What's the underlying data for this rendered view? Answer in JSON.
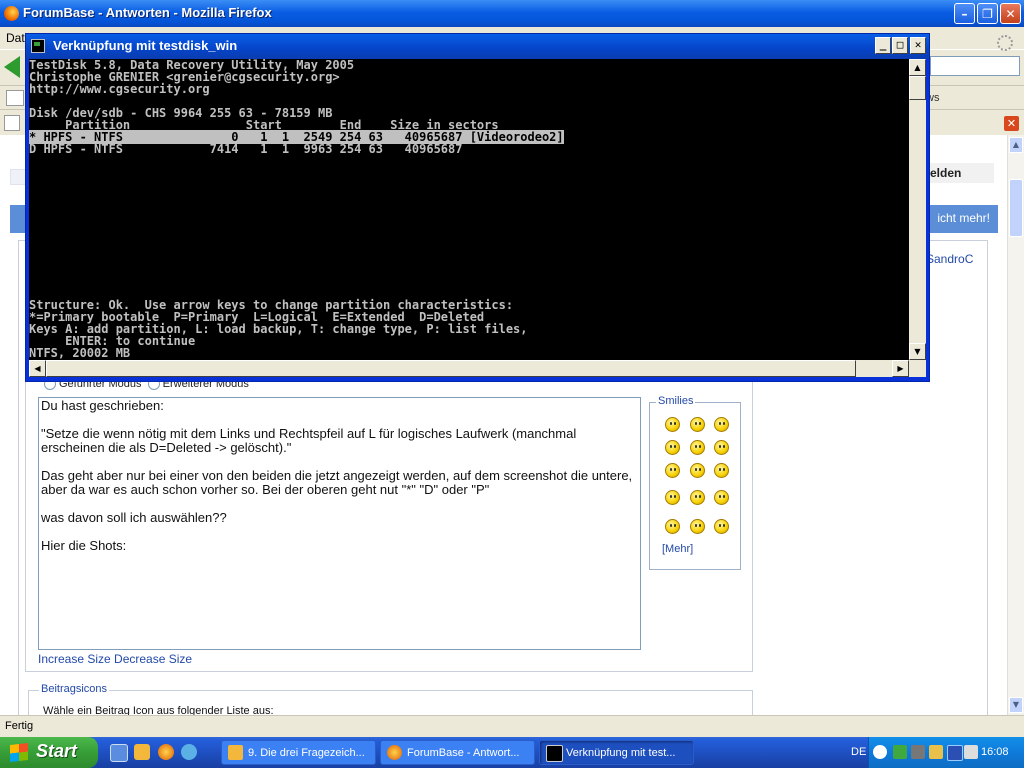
{
  "firefox": {
    "title": "ForumBase - Antworten - Mozilla Firefox",
    "menubar_visible": "Dat",
    "bookmark_partial": "ws",
    "status": "Fertig"
  },
  "page": {
    "melden": "elden",
    "bluebar_text": "icht mehr!",
    "user_link": "SandroC",
    "mode_guided": "Geführter Modus",
    "mode_extended": "Erweiterer Modus",
    "editor_paragraphs": [
      "Du hast geschrieben:",
      "\"Setze die wenn nötig mit dem Links und Rechtspfeil auf L für logisches Laufwerk (manchmal erscheinen die als D=Deleted -> gelöscht).\"",
      "Das geht aber nur bei einer von den beiden die jetzt angezeigt werden, auf dem screenshot die untere, aber da war es auch schon vorher so. Bei der oberen geht nut \"*\" \"D\" oder \"P\"",
      "was davon soll ich auswählen??",
      "Hier die Shots:"
    ],
    "increase_size": "Increase Size",
    "decrease_size": "Decrease Size",
    "smilies_legend": "Smilies",
    "smilies_more": "[Mehr]",
    "beitragsicons_legend": "Beitragsicons",
    "beitragsicons_desc": "Wähle ein Beitrag Icon aus folgender Liste aus:"
  },
  "console": {
    "title": "Verknüpfung mit testdisk_win",
    "lines": [
      "TestDisk 5.8, Data Recovery Utility, May 2005",
      "Christophe GRENIER <grenier@cgsecurity.org>",
      "http://www.cgsecurity.org",
      "",
      "Disk /dev/sdb - CHS 9964 255 63 - 78159 MB",
      "     Partition                Start        End    Size in sectors",
      "* HPFS - NTFS               0   1  1  2549 254 63   40965687 [Videorodeo2]",
      "D HPFS - NTFS            7414   1  1  9963 254 63   40965687",
      "",
      "",
      "",
      "",
      "",
      "",
      "",
      "",
      "",
      "",
      "",
      "",
      "Structure: Ok.  Use arrow keys to change partition characteristics:",
      "*=Primary bootable  P=Primary  L=Logical  E=Extended  D=Deleted",
      "Keys A: add partition, L: load backup, T: change type, P: list files,",
      "     ENTER: to continue",
      "NTFS, 20002 MB"
    ],
    "highlight_line": 6
  },
  "taskbar": {
    "start": "Start",
    "tasks": [
      "9. Die drei Fragezeich...",
      "ForumBase - Antwort...",
      "Verknüpfung mit test..."
    ],
    "lang": "DE",
    "clock": "16:08"
  },
  "colors": {
    "console_bg": "#000000",
    "console_fg": "#c0c0c0",
    "xp_blue": "#0a5de3",
    "link": "#2249a8"
  }
}
